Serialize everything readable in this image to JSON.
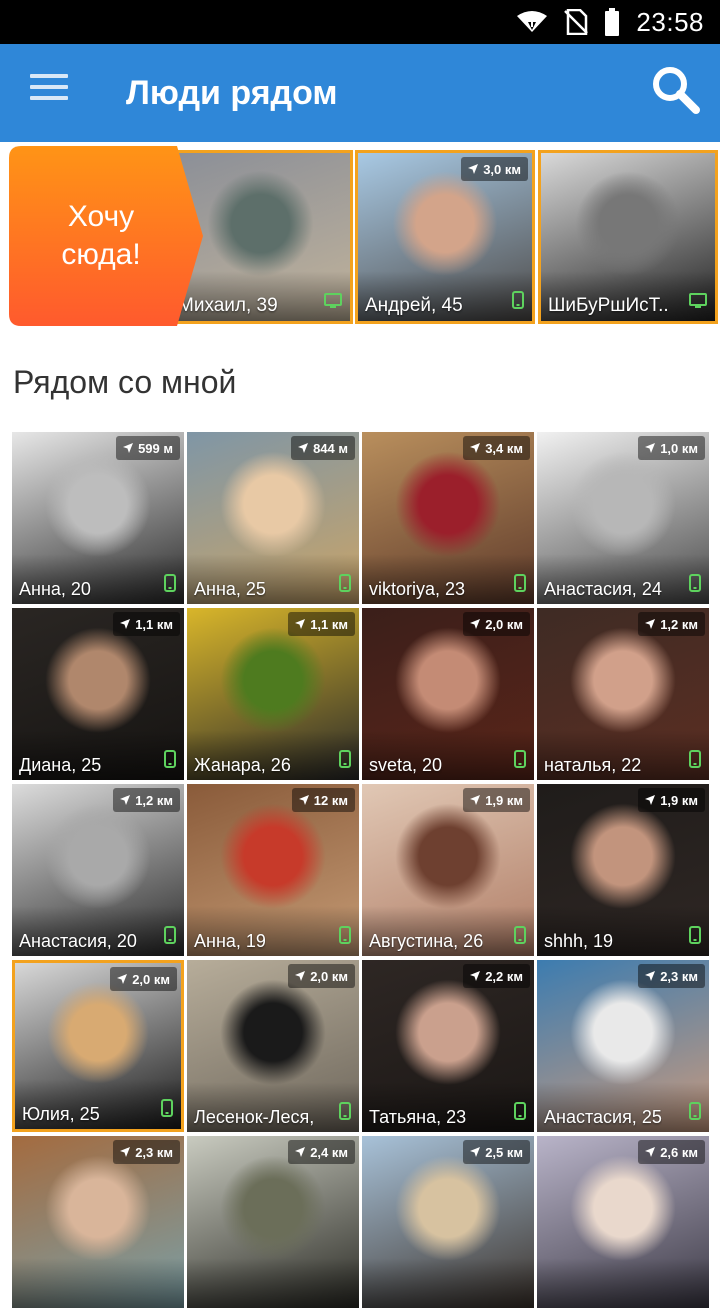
{
  "status": {
    "time": "23:58"
  },
  "app_bar": {
    "title": "Люди рядом"
  },
  "promo": {
    "cta_label": "Хочу\nсюда!"
  },
  "featured": [
    {
      "name": "Михаил, 39",
      "distance": "",
      "device": "desktop",
      "colors": [
        "#8b8f98",
        "#5d6f6a",
        "#c1b39b"
      ]
    },
    {
      "name": "Андрей, 45",
      "distance": "3,0 км",
      "device": "mobile",
      "colors": [
        "#a8c9e4",
        "#d3a48a",
        "#4d4a48"
      ]
    },
    {
      "name": "ШиБуРшИсТ..",
      "distance": "",
      "device": "desktop",
      "colors": [
        "#d9d9d9",
        "#777777",
        "#222222"
      ]
    }
  ],
  "section_title": "Рядом со мной",
  "people": [
    {
      "name": "Анна, 20",
      "distance": "599 м",
      "colors": [
        "#e7e7e7",
        "#bdbdbd",
        "#2a2a2a"
      ]
    },
    {
      "name": "Анна, 25",
      "distance": "844 м",
      "colors": [
        "#7f96a6",
        "#e8c9a5",
        "#c9a468"
      ]
    },
    {
      "name": "viktoriya, 23",
      "distance": "3,4 км",
      "colors": [
        "#b98f5d",
        "#9b1f2b",
        "#5e3a2a"
      ]
    },
    {
      "name": "Анастасия, 24",
      "distance": "1,0 км",
      "colors": [
        "#f1f1f1",
        "#b7b7b7",
        "#4a4a4a"
      ]
    },
    {
      "name": "Диана, 25",
      "distance": "1,1 км",
      "colors": [
        "#2a2623",
        "#b0876c",
        "#161412"
      ]
    },
    {
      "name": "Жанара, 26",
      "distance": "1,1 км",
      "colors": [
        "#d9b62a",
        "#4e7b1f",
        "#2a2a2a"
      ]
    },
    {
      "name": "sveta, 20",
      "distance": "2,0 км",
      "colors": [
        "#3b1f1a",
        "#c48b75",
        "#5a2519"
      ]
    },
    {
      "name": "наталья, 22",
      "distance": "1,2 км",
      "colors": [
        "#3e2b24",
        "#d1a08a",
        "#5c2e22"
      ]
    },
    {
      "name": "Анастасия, 20",
      "distance": "1,2 км",
      "colors": [
        "#dcdcdc",
        "#a9a9a9",
        "#2b2b2b"
      ]
    },
    {
      "name": "Анна, 19",
      "distance": "12 км",
      "colors": [
        "#8a5b3a",
        "#c73a2a",
        "#c49a74"
      ]
    },
    {
      "name": "Августина, 26",
      "distance": "1,9 км",
      "colors": [
        "#e1c8b5",
        "#6e4030",
        "#b07d66"
      ]
    },
    {
      "name": "shhh, 19",
      "distance": "1,9 км",
      "colors": [
        "#1f1c1a",
        "#c2947d",
        "#2f2724"
      ]
    },
    {
      "name": "Юлия, 25",
      "distance": "2,0 км",
      "colors": [
        "#d8d8d8",
        "#d8aa72",
        "#1c1c1c"
      ],
      "selected": true
    },
    {
      "name": "Лесенок-Леся,",
      "distance": "2,0 км",
      "colors": [
        "#b7ad9a",
        "#1a1a1a",
        "#6d665b"
      ]
    },
    {
      "name": "Татьяна, 23",
      "distance": "2,2 км",
      "colors": [
        "#2e2724",
        "#caa08d",
        "#1b1715"
      ]
    },
    {
      "name": "Анастасия, 25",
      "distance": "2,3 км",
      "colors": [
        "#3c7cb0",
        "#e9e9e9",
        "#c89a7e"
      ]
    },
    {
      "name": "",
      "distance": "2,3 км",
      "colors": [
        "#a46b3f",
        "#d9b59a",
        "#7a9fa6"
      ]
    },
    {
      "name": "",
      "distance": "2,4 км",
      "colors": [
        "#c9cbc0",
        "#6b6e59",
        "#2c2c26"
      ]
    },
    {
      "name": "",
      "distance": "2,5 км",
      "colors": [
        "#a8c2d9",
        "#d7c2a0",
        "#3d342d"
      ]
    },
    {
      "name": "",
      "distance": "2,6 км",
      "colors": [
        "#b9b4c9",
        "#e9d8cc",
        "#3d3a46"
      ]
    }
  ]
}
